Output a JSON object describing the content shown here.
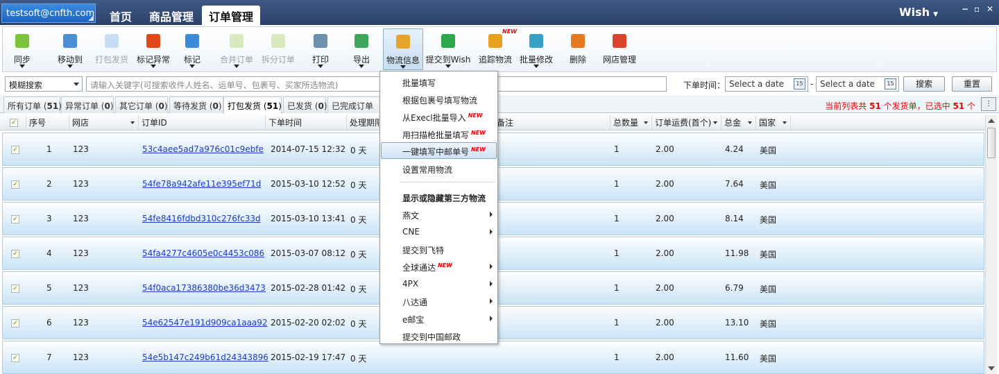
{
  "account": "testsoft@cnfth.com",
  "nav_tabs": [
    "首页",
    "商品管理",
    "订单管理"
  ],
  "store_name": "Wish",
  "window_buttons": [
    "−",
    "▫",
    "✕"
  ],
  "toolbar": [
    {
      "label": "同步",
      "icon": "sync-arrow-icon",
      "color": "#7cc33a",
      "drop": true,
      "disabled": false
    },
    {
      "label": "移动到",
      "icon": "move-to-icon",
      "color": "#4a8fd6",
      "drop": true,
      "disabled": false
    },
    {
      "label": "打包发货",
      "icon": "pack-ship-icon",
      "color": "#6aa3e0",
      "drop": false,
      "disabled": true
    },
    {
      "label": "标记异常",
      "icon": "red-flag-icon",
      "color": "#e2471b",
      "drop": true,
      "disabled": false
    },
    {
      "label": "标记",
      "icon": "blue-flag-icon",
      "color": "#3d8ad9",
      "drop": true,
      "disabled": false
    },
    {
      "label": "合并订单",
      "icon": "merge-order-icon",
      "color": "#9acb4a",
      "drop": true,
      "disabled": true
    },
    {
      "label": "拆分订单",
      "icon": "split-order-icon",
      "color": "#9acb4a",
      "drop": false,
      "disabled": true
    },
    {
      "label": "打印",
      "icon": "printer-icon",
      "color": "#6f8fb0",
      "drop": true,
      "disabled": false
    },
    {
      "label": "导出",
      "icon": "export-icon",
      "color": "#3fa55a",
      "drop": true,
      "disabled": false
    },
    {
      "label": "物流信息",
      "icon": "pencil-icon",
      "color": "#e6a42a",
      "drop": true,
      "disabled": false
    },
    {
      "label": "提交到Wish",
      "icon": "submit-arrow-icon",
      "color": "#2fa84a",
      "drop": true,
      "disabled": false
    },
    {
      "label": "追踪物流",
      "icon": "truck-icon",
      "color": "#e8a020",
      "drop": false,
      "disabled": false,
      "badge": "NEW"
    },
    {
      "label": "批量修改",
      "icon": "batch-edit-icon",
      "color": "#3aa0c8",
      "drop": true,
      "disabled": false
    },
    {
      "label": "删除",
      "icon": "trash-icon",
      "color": "#e67a1e",
      "drop": false,
      "disabled": false
    },
    {
      "label": "网店管理",
      "icon": "store-icon",
      "color": "#d9452b",
      "drop": false,
      "disabled": false
    }
  ],
  "search": {
    "mode": "模糊搜索",
    "placeholder": "请输入关键字(可搜索收件人姓名、运单号、包裹号、买家所选物流)",
    "date_label": "下单时间：",
    "date_from": "Select a date",
    "date_to": "Select a date",
    "date_sep": "-",
    "calendar_day": "15",
    "search_btn": "搜索",
    "reset_btn": "重置"
  },
  "filter_tabs": [
    {
      "name": "所有订单",
      "count": "51"
    },
    {
      "name": "异常订单",
      "count": "0"
    },
    {
      "name": "其它订单",
      "count": "0"
    },
    {
      "name": "等待发货",
      "count": "0"
    },
    {
      "name": "打包发货",
      "count": "51"
    },
    {
      "name": "已发货",
      "count": "0"
    },
    {
      "name": "已完成订单",
      "count": ""
    }
  ],
  "summary": {
    "prefix": "当前列表共 ",
    "total": "51",
    "mid": " 个发货单，已选中 ",
    "selected": "51",
    "suffix": " 个"
  },
  "columns": [
    "序号",
    "网店",
    "订单ID",
    "下单时间",
    "处理期限",
    "备注",
    "总数量",
    "订单运费(首个)",
    "总金",
    "国家"
  ],
  "rows": [
    {
      "no": "1",
      "store": "123",
      "order_id": "53c4aee5ad7a976c01c9ebfe",
      "date": "2014-07-15 12:32",
      "period": "0 天",
      "qty": "1",
      "freight": "2.00",
      "total": "4.24",
      "country": "美国"
    },
    {
      "no": "2",
      "store": "123",
      "order_id": "54fe78a942afe11e395ef71d",
      "date": "2015-03-10 12:52",
      "period": "0 天",
      "qty": "1",
      "freight": "2.00",
      "total": "7.64",
      "country": "美国"
    },
    {
      "no": "3",
      "store": "123",
      "order_id": "54fe8416fdbd310c276fc33d",
      "date": "2015-03-10 13:41",
      "period": "0 天",
      "qty": "1",
      "freight": "2.00",
      "total": "8.14",
      "country": "美国"
    },
    {
      "no": "4",
      "store": "123",
      "order_id": "54fa4277c4605e0c4453c086",
      "date": "2015-03-07 08:12",
      "period": "0 天",
      "qty": "1",
      "freight": "2.00",
      "total": "11.98",
      "country": "美国"
    },
    {
      "no": "5",
      "store": "123",
      "order_id": "54f0aca17386380be36d3473",
      "date": "2015-02-28 01:42",
      "period": "0 天",
      "qty": "1",
      "freight": "2.00",
      "total": "6.79",
      "country": "美国"
    },
    {
      "no": "6",
      "store": "123",
      "order_id": "54e62547e191d909ca1aaa92",
      "date": "2015-02-20 02:02",
      "period": "0 天",
      "qty": "1",
      "freight": "2.00",
      "total": "13.10",
      "country": "美国"
    },
    {
      "no": "7",
      "store": "123",
      "order_id": "54e5b147c249b61d24343896",
      "date": "2015-02-19 17:47",
      "period": "0 天",
      "qty": "1",
      "freight": "2.00",
      "total": "11.60",
      "country": "美国"
    }
  ],
  "menu": [
    {
      "label": "批量填写"
    },
    {
      "label": "根据包裹号填写物流"
    },
    {
      "label": "从Execl批量导入",
      "badge": "NEW"
    },
    {
      "label": "用扫描枪批量填写",
      "badge": "NEW"
    },
    {
      "label": "一键填写中邮单号",
      "badge": "NEW",
      "hover": true
    },
    {
      "label": "设置常用物流"
    },
    {
      "sep": true
    },
    {
      "label": "显示或隐藏第三方物流",
      "bold": true
    },
    {
      "label": "燕文",
      "sub": true
    },
    {
      "label": "CNE",
      "sub": true
    },
    {
      "label": "提交到飞特"
    },
    {
      "label": "全球通达",
      "badge": "NEW",
      "sub": true
    },
    {
      "label": "4PX",
      "sub": true
    },
    {
      "label": "八达通",
      "sub": true
    },
    {
      "label": "e邮宝",
      "sub": true
    },
    {
      "label": "提交到中国邮政"
    }
  ]
}
